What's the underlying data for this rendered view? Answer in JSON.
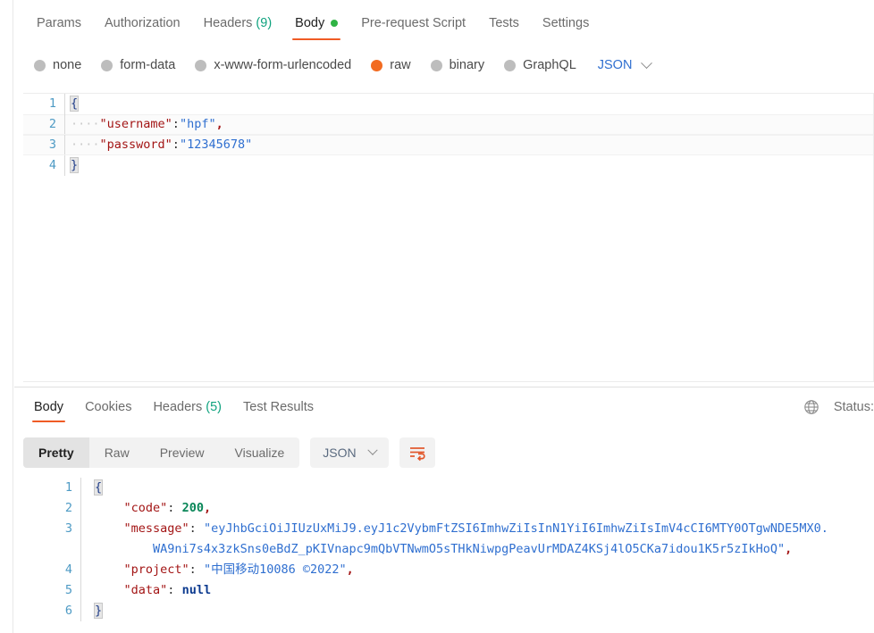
{
  "request": {
    "tabs": [
      {
        "label": "Params",
        "active": false,
        "count": null,
        "dot": false
      },
      {
        "label": "Authorization",
        "active": false,
        "count": null,
        "dot": false
      },
      {
        "label": "Headers",
        "active": false,
        "count": "(9)",
        "dot": false
      },
      {
        "label": "Body",
        "active": true,
        "count": null,
        "dot": true
      },
      {
        "label": "Pre-request Script",
        "active": false,
        "count": null,
        "dot": false
      },
      {
        "label": "Tests",
        "active": false,
        "count": null,
        "dot": false
      },
      {
        "label": "Settings",
        "active": false,
        "count": null,
        "dot": false
      }
    ],
    "body_types": [
      {
        "label": "none",
        "selected": false
      },
      {
        "label": "form-data",
        "selected": false
      },
      {
        "label": "x-www-form-urlencoded",
        "selected": false
      },
      {
        "label": "raw",
        "selected": true
      },
      {
        "label": "binary",
        "selected": false
      },
      {
        "label": "GraphQL",
        "selected": false
      }
    ],
    "format_select": "JSON",
    "editor": {
      "lines": [
        {
          "n": "1",
          "open_brace": "{"
        },
        {
          "n": "2",
          "indent": "····",
          "key": "\"username\"",
          "colon": ":",
          "value": "\"hpf\"",
          "comma": ","
        },
        {
          "n": "3",
          "indent": "····",
          "key": "\"password\"",
          "colon": ":",
          "value": "\"12345678\"",
          "comma": ""
        },
        {
          "n": "4",
          "close_brace": "}"
        }
      ]
    }
  },
  "response": {
    "tabs": [
      {
        "label": "Body",
        "active": true,
        "count": null
      },
      {
        "label": "Cookies",
        "active": false,
        "count": null
      },
      {
        "label": "Headers",
        "active": false,
        "count": "(5)"
      },
      {
        "label": "Test Results",
        "active": false,
        "count": null
      }
    ],
    "status_label": "Status:",
    "globe_icon": "globe-icon",
    "view_modes": [
      {
        "label": "Pretty",
        "active": true
      },
      {
        "label": "Raw",
        "active": false
      },
      {
        "label": "Preview",
        "active": false
      },
      {
        "label": "Visualize",
        "active": false
      }
    ],
    "format_select": "JSON",
    "wrap_icon": "wrap-lines-icon",
    "body": {
      "line1_num": "1",
      "line1_brace": "{",
      "line2_num": "2",
      "line2_key": "\"code\"",
      "line2_value": "200",
      "line2_comma": ",",
      "line3_num": "3",
      "line3_key": "\"message\"",
      "line3_value_part1": "\"eyJhbGciOiJIUzUxMiJ9.eyJ1c2VybmFtZSI6ImhwZiIsInN1YiI6ImhwZiIsImV4cCI6MTY0OTgwNDE5MX0.",
      "line3_value_part2": "WA9ni7s4x3zkSns0eBdZ_pKIVnapc9mQbVTNwmO5sTHkNiwpgPeavUrMDAZ4KSj4lO5CKa7idou1K5r5zIkHoQ\"",
      "line3_comma": ",",
      "line4_num": "4",
      "line4_key": "\"project\"",
      "line4_value": "\"中国移动10086 ©2022\"",
      "line4_comma": ",",
      "line5_num": "5",
      "line5_key": "\"data\"",
      "line5_value": "null",
      "line6_num": "6",
      "line6_brace": "}"
    }
  },
  "colors": {
    "accent_orange": "#ef5b25",
    "radio_selected": "#f26b21",
    "green_dot": "#2fb344",
    "count_green": "#10a37f",
    "link_blue": "#2f6fd0",
    "string_blue": "#2f6fd0",
    "key_red": "#a31515",
    "number_green": "#098658"
  }
}
